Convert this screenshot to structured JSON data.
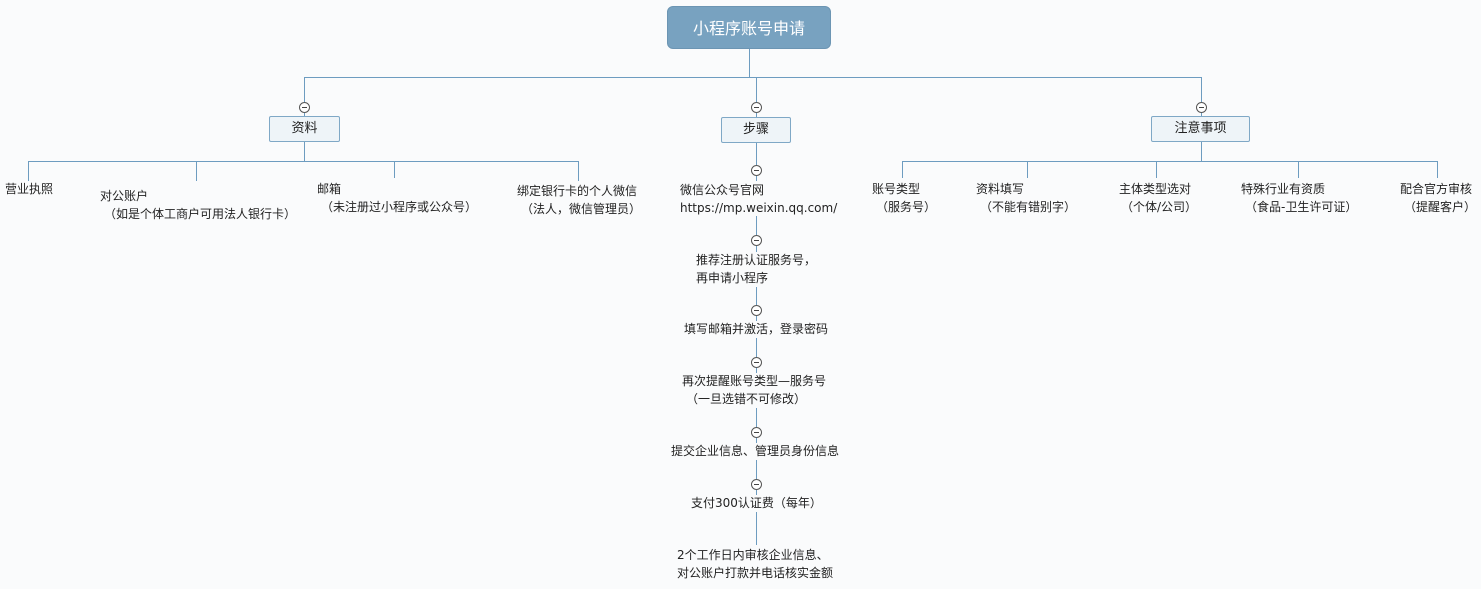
{
  "root": {
    "label": "小程序账号申请"
  },
  "branches": [
    {
      "label": "资料",
      "items": [
        {
          "line1": "营业执照",
          "line2": ""
        },
        {
          "line1": "对公账户",
          "line2": "（如是个体工商户可用法人银行卡）"
        },
        {
          "line1": "邮箱",
          "line2": "（未注册过小程序或公众号）"
        },
        {
          "line1": "绑定银行卡的个人微信",
          "line2": "（法人，微信管理员）"
        }
      ]
    },
    {
      "label": "步骤",
      "items": [
        {
          "line1": "微信公众号官网",
          "line2": "https://mp.weixin.qq.com/"
        },
        {
          "line1": "推荐注册认证服务号，",
          "line2": "再申请小程序"
        },
        {
          "line1": "填写邮箱并激活，登录密码",
          "line2": ""
        },
        {
          "line1": "再次提醒账号类型—服务号",
          "line2": "（一旦选错不可修改）"
        },
        {
          "line1": "提交企业信息、管理员身份信息",
          "line2": ""
        },
        {
          "line1": "支付300认证费（每年）",
          "line2": ""
        },
        {
          "line1": "2个工作日内审核企业信息、",
          "line2": "对公账户打款并电话核实金额"
        }
      ]
    },
    {
      "label": "注意事项",
      "items": [
        {
          "line1": "账号类型",
          "line2": "（服务号）"
        },
        {
          "line1": "资料填写",
          "line2": "（不能有错别字）"
        },
        {
          "line1": "主体类型选对",
          "line2": "（个体/公司）"
        },
        {
          "line1": "特殊行业有资质",
          "line2": "（食品-卫生许可证）"
        },
        {
          "line1": "配合官方审核",
          "line2": "（提醒客户）"
        }
      ]
    }
  ]
}
